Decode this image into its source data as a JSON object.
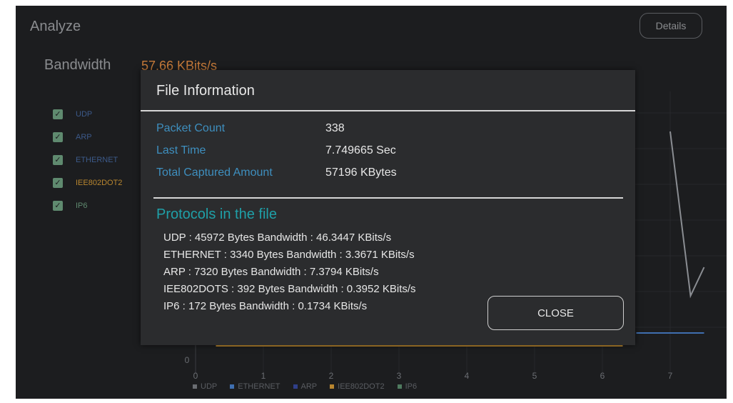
{
  "app": {
    "title": "Analyze",
    "details_label": "Details"
  },
  "bandwidth": {
    "label": "Bandwidth",
    "value": "57.66 KBits/s"
  },
  "protocol_filters": [
    {
      "name": "UDP",
      "checked": true,
      "color": "#3c5a8a"
    },
    {
      "name": "ARP",
      "checked": true,
      "color": "#3c5a8a"
    },
    {
      "name": "ETHERNET",
      "checked": true,
      "color": "#3c5a8a"
    },
    {
      "name": "IEE802DOT2",
      "checked": true,
      "color": "#b8862f"
    },
    {
      "name": "IP6",
      "checked": true,
      "color": "#5f8a6f"
    }
  ],
  "chart_data": {
    "type": "line",
    "x_ticks": [
      "0",
      "1",
      "2",
      "3",
      "4",
      "5",
      "6",
      "7"
    ],
    "y_ticks": [
      "0"
    ],
    "xlim": [
      0,
      7.5
    ],
    "series_legend": [
      {
        "name": "UDP",
        "color": "#6a6d72"
      },
      {
        "name": "ETHERNET",
        "color": "#3f6fb0"
      },
      {
        "name": "ARP",
        "color": "#2f3f8a"
      },
      {
        "name": "IEE802DOT2",
        "color": "#b8862f"
      },
      {
        "name": "IP6",
        "color": "#4f7a5f"
      }
    ],
    "visible_series": [
      {
        "name": "UDP",
        "color": "#8a8d92",
        "points": [
          [
            7.0,
            300
          ],
          [
            7.3,
            70
          ],
          [
            7.5,
            110
          ]
        ]
      },
      {
        "name": "ETHERNET",
        "color": "#3f6fb0",
        "points": [
          [
            6.5,
            18
          ],
          [
            7.5,
            18
          ]
        ]
      },
      {
        "name": "IEE802DOT2",
        "color": "#b8862f",
        "points": [
          [
            0.3,
            0
          ],
          [
            6.3,
            0
          ]
        ]
      }
    ]
  },
  "modal": {
    "title": "File Information",
    "info": [
      {
        "key": "Packet Count",
        "value": "338"
      },
      {
        "key": "Last Time",
        "value": "7.749665 Sec"
      },
      {
        "key": "Total Captured Amount",
        "value": "57196 KBytes"
      }
    ],
    "protocols_title": "Protocols in the file",
    "protocol_lines": [
      "UDP : 45972 Bytes   Bandwidth : 46.3447 KBits/s",
      "ETHERNET : 3340 Bytes   Bandwidth : 3.3671 KBits/s",
      "ARP : 7320 Bytes   Bandwidth : 7.3794 KBits/s",
      "IEE802DOTS : 392 Bytes   Bandwidth : 0.3952 KBits/s",
      "IP6 : 172 Bytes   Bandwidth : 0.1734 KBits/s"
    ],
    "close_label": "CLOSE"
  }
}
